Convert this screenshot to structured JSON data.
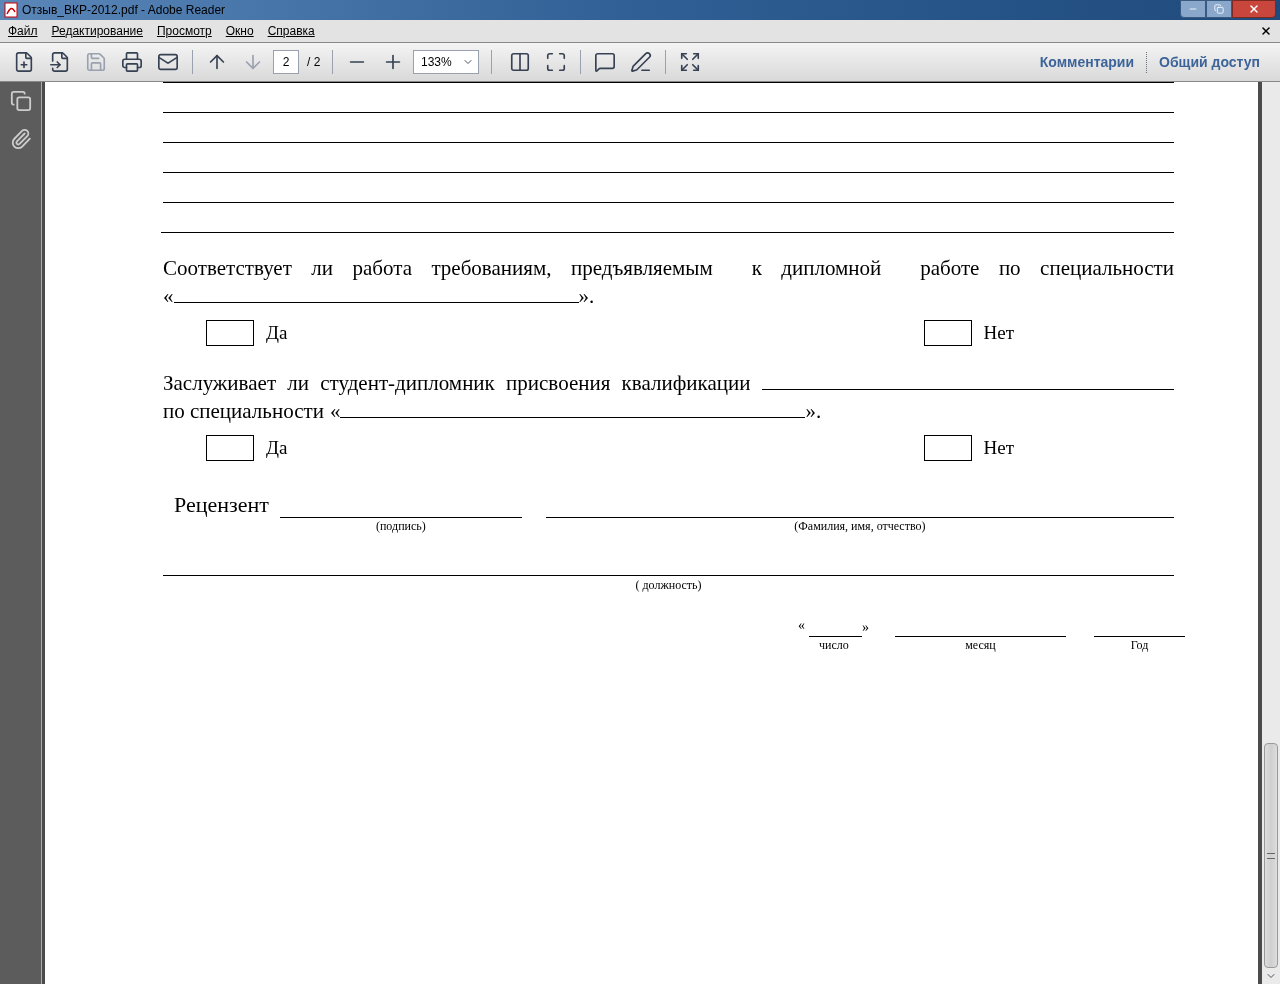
{
  "window": {
    "title": "Отзыв_ВКР-2012.pdf - Adobe Reader"
  },
  "menu": [
    "Файл",
    "Редактирование",
    "Просмотр",
    "Окно",
    "Справка"
  ],
  "toolbar": {
    "page": "2",
    "page_total": "/ 2",
    "zoom": "133%",
    "links": [
      "Комментарии",
      "Общий доступ"
    ]
  },
  "document": {
    "questions": [
      {
        "line1": "Соответствует ли работа требованиям, предъявляемым  к дипломной  работе по специальности",
        "open_quote": "«",
        "close_quote": "».",
        "options": [
          {
            "label": "Да",
            "checked": false
          },
          {
            "label": "Нет",
            "checked": false
          }
        ]
      },
      {
        "line1": "Заслуживает ли студент-дипломник присвоения квалификации",
        "line2_prefix": "по специальности",
        "open_quote": "«",
        "close_quote": "».",
        "options": [
          {
            "label": "Да",
            "checked": false
          },
          {
            "label": "Нет",
            "checked": false
          }
        ]
      }
    ],
    "reviewer": {
      "label": "Рецензент",
      "signature_caption": "(подпись)",
      "name_caption": "(Фамилия, имя, отчество)",
      "position_caption": "( должность)"
    },
    "date": {
      "open_quote": "«",
      "close_quote": "»",
      "day_caption": "число",
      "month_caption": "месяц",
      "year_caption": "Год"
    }
  }
}
